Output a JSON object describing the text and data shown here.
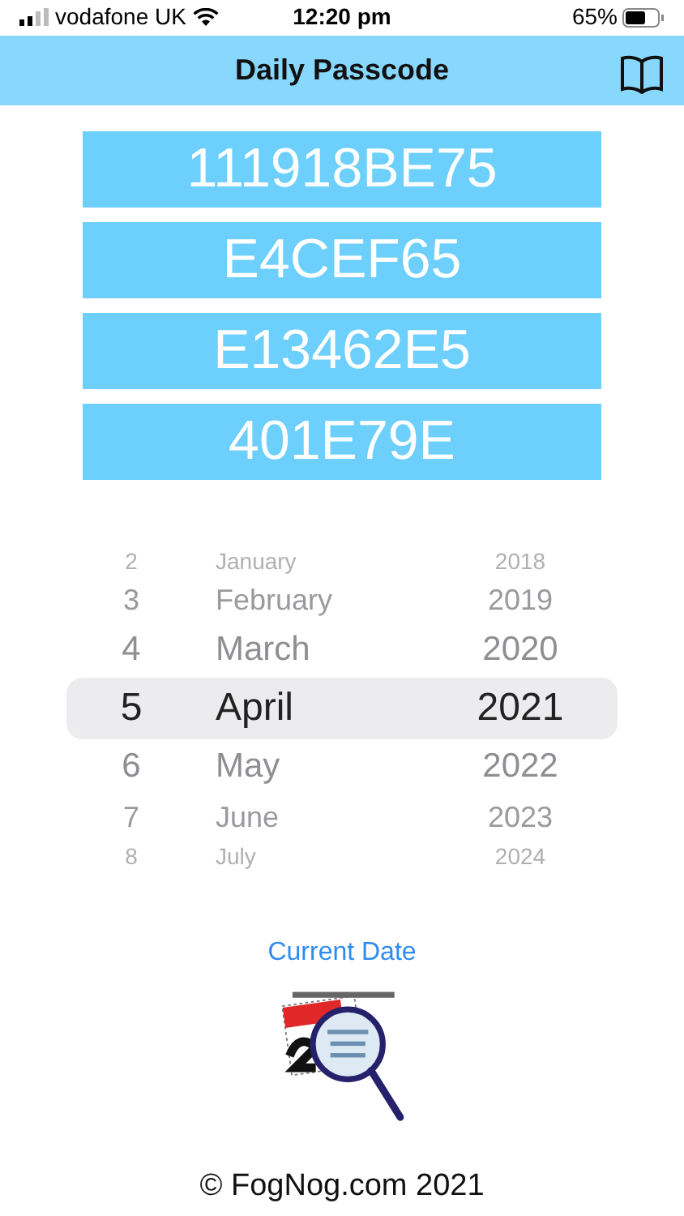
{
  "status_bar": {
    "carrier": "vodafone UK",
    "time": "12:20 pm",
    "battery": "65%"
  },
  "nav_bar": {
    "title": "Daily Passcode"
  },
  "passcodes": [
    "111918BE75",
    "E4CEF65",
    "E13462E5",
    "401E79E"
  ],
  "date_picker": {
    "rows": [
      {
        "day": "2",
        "month": "January",
        "year": "2018",
        "selected": false
      },
      {
        "day": "3",
        "month": "February",
        "year": "2019",
        "selected": false
      },
      {
        "day": "4",
        "month": "March",
        "year": "2020",
        "selected": false
      },
      {
        "day": "5",
        "month": "April",
        "year": "2021",
        "selected": true
      },
      {
        "day": "6",
        "month": "May",
        "year": "2022",
        "selected": false
      },
      {
        "day": "7",
        "month": "June",
        "year": "2023",
        "selected": false
      },
      {
        "day": "8",
        "month": "July",
        "year": "2024",
        "selected": false
      }
    ]
  },
  "current_date_button": "Current Date",
  "footer": "© FogNog.com 2021"
}
